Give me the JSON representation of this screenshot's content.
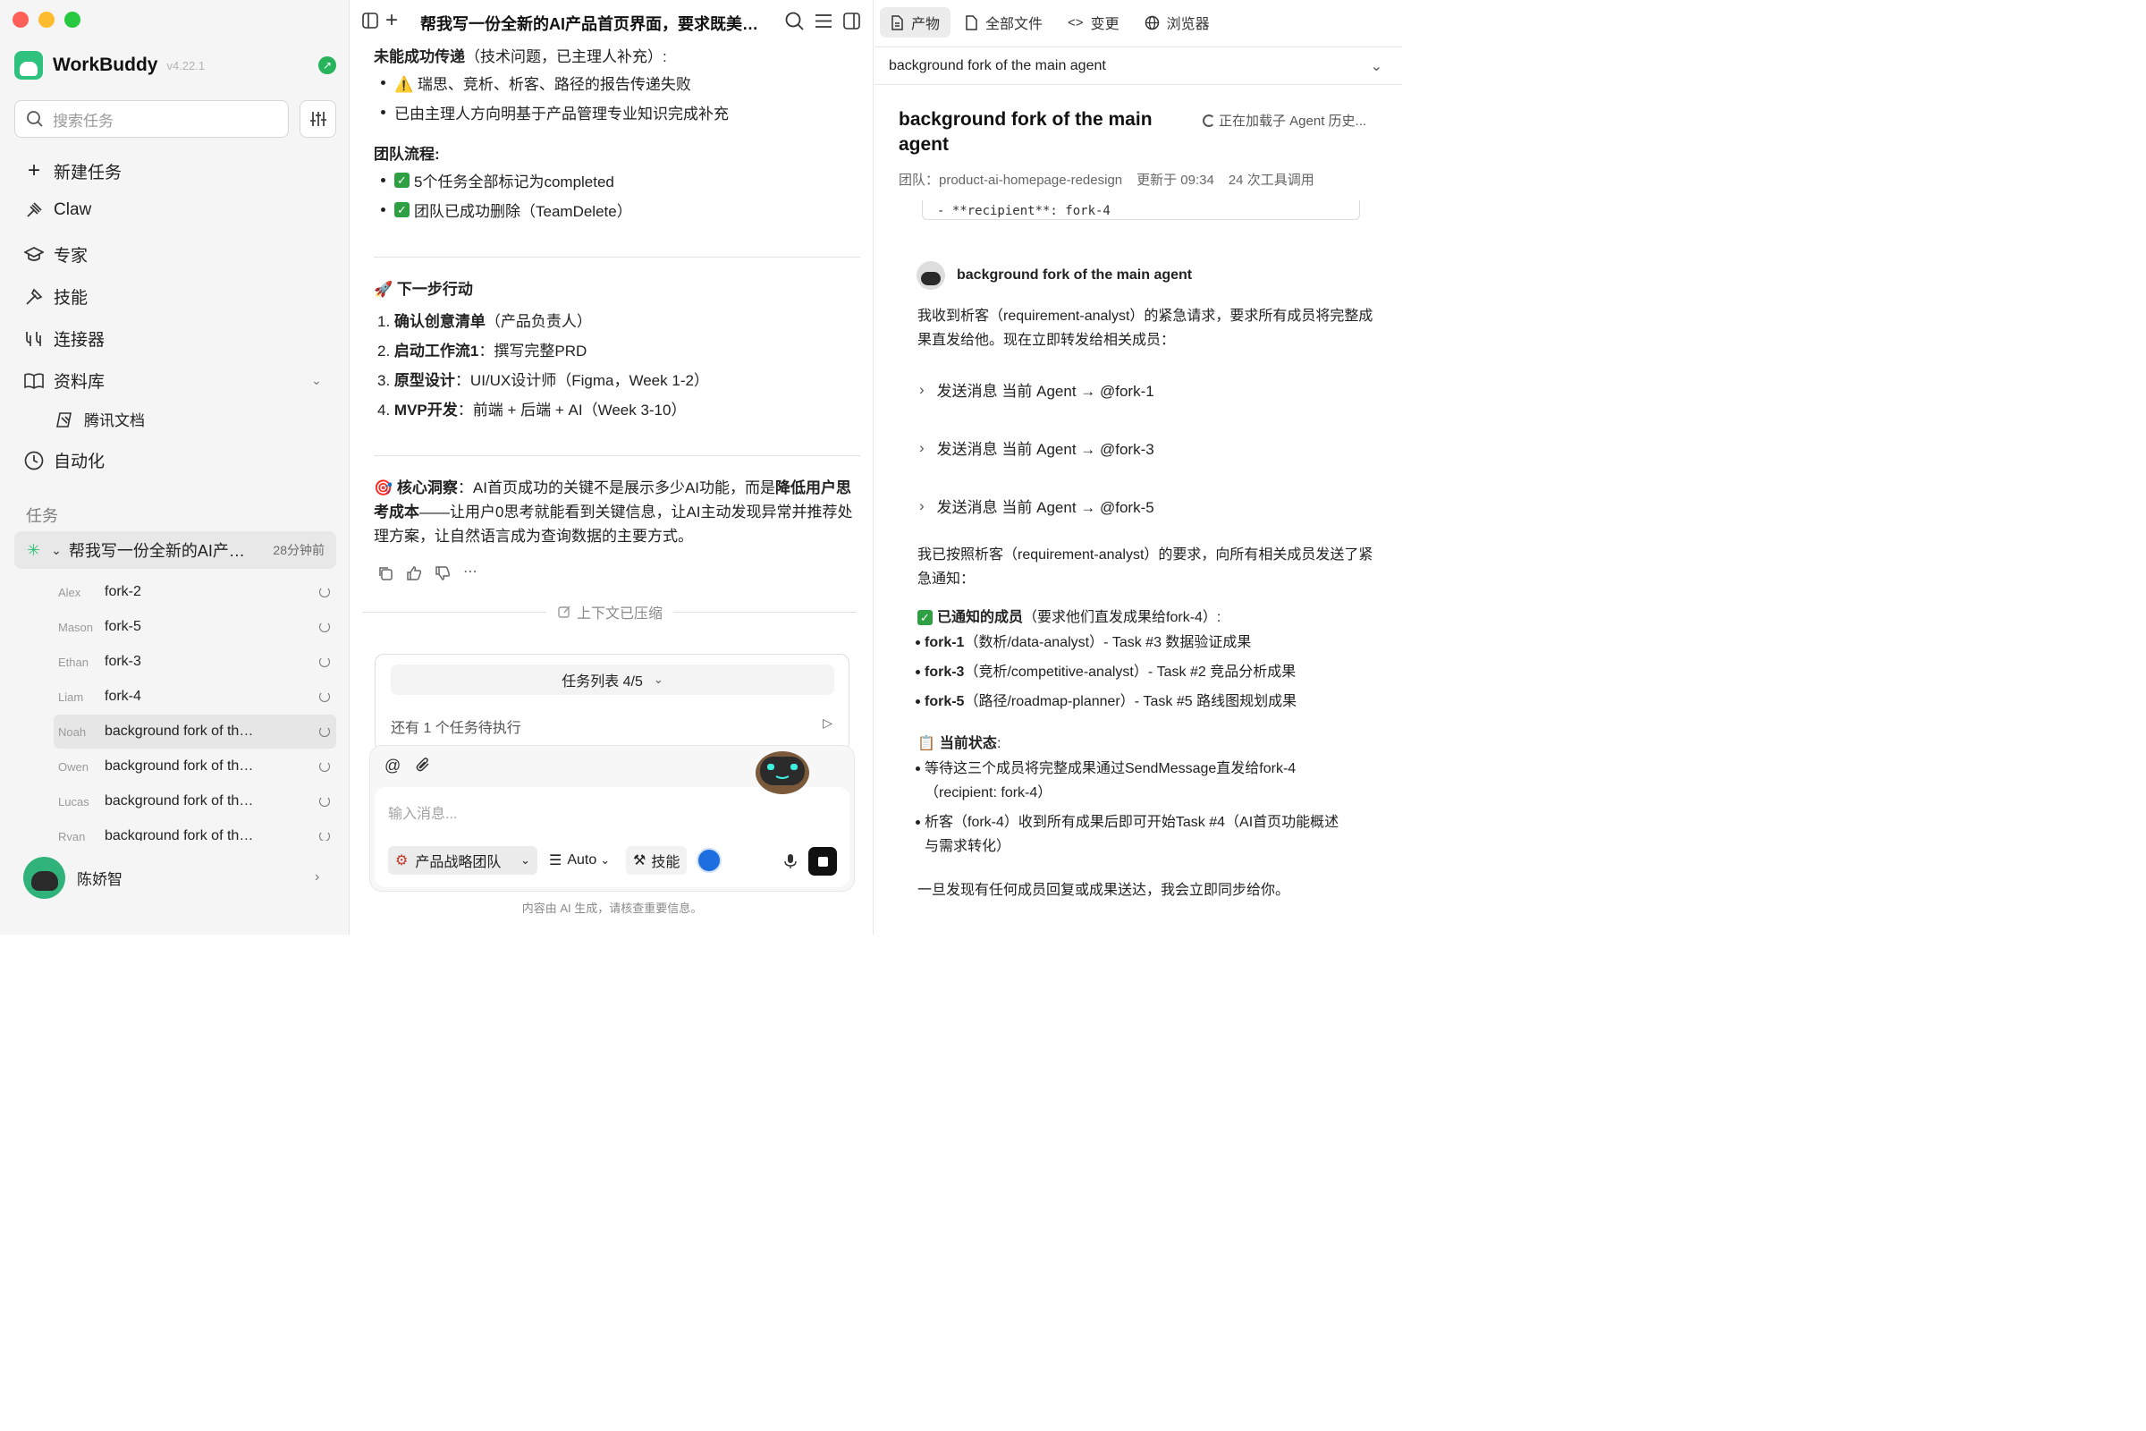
{
  "sidebar": {
    "brand": "WorkBuddy",
    "version": "v4.22.1",
    "search_placeholder": "搜索任务",
    "nav": [
      {
        "label": "新建任务",
        "icon": "plus-icon"
      },
      {
        "label": "Claw",
        "icon": "claw-icon"
      },
      {
        "label": "专家",
        "icon": "graduation-cap-icon"
      },
      {
        "label": "技能",
        "icon": "tools-icon"
      },
      {
        "label": "连接器",
        "icon": "connector-icon"
      },
      {
        "label": "资料库",
        "icon": "book-icon"
      },
      {
        "label": "腾讯文档",
        "icon": "doc-icon"
      },
      {
        "label": "自动化",
        "icon": "clock-icon"
      }
    ],
    "tasks_label": "任务",
    "current_task": {
      "title": "帮我写一份全新的AI产品首页界面，要求既美观又…",
      "time": "28分钟前"
    },
    "subtasks": [
      {
        "who": "Alex",
        "name": "fork-2"
      },
      {
        "who": "Mason",
        "name": "fork-5"
      },
      {
        "who": "Ethan",
        "name": "fork-3"
      },
      {
        "who": "Liam",
        "name": "fork-4"
      },
      {
        "who": "Noah",
        "name": "background fork of the main agent"
      },
      {
        "who": "Owen",
        "name": "background fork of the main agent"
      },
      {
        "who": "Lucas",
        "name": "background fork of the main agent"
      },
      {
        "who": "Ryan",
        "name": "background fork of the main agent"
      }
    ],
    "user_name": "陈娇智"
  },
  "middle": {
    "title": "帮我写一份全新的AI产品首页界面，要求既美观又实用",
    "failed_heading": "未能成功传递",
    "failed_note": "（技术问题，已主理人补充）:",
    "failed_items": [
      "⚠️ 瑞思、竞析、析客、路径的报告传递失败",
      "已由主理人方向明基于产品管理专业知识完成补充"
    ],
    "flow_heading": "团队流程:",
    "flow_items": [
      "5个任务全部标记为completed",
      "团队已成功删除（TeamDelete）"
    ],
    "next_heading": "🚀 下一步行动",
    "next_items": [
      {
        "n": "1.",
        "b": "确认创意清单",
        "r": "（产品负责人）"
      },
      {
        "n": "2.",
        "b": "启动工作流1",
        "r": "：撰写完整PRD"
      },
      {
        "n": "3.",
        "b": "原型设计",
        "r": "：UI/UX设计师（Figma，Week 1-2）"
      },
      {
        "n": "4.",
        "b": "MVP开发",
        "r": "：前端 + 后端 + AI（Week 3-10）"
      }
    ],
    "insight_label": "🎯 核心洞察",
    "insight_a": "：AI首页成功的关键不是展示多少AI功能，而是",
    "insight_b": "降低用户思考成本",
    "insight_c": "——让用户0思考就能看到关键信息，让AI主动发现异常并推荐处理方案，让自然语言成为查询数据的主要方式。",
    "compressed": "上下文已压缩",
    "tasklist_label": "任务列表 4/5",
    "pending": "还有 1 个任务待执行",
    "input_placeholder": "输入消息...",
    "team": "产品战略团队",
    "model": "Auto",
    "skills": "技能",
    "disclaimer": "内容由 AI 生成，请核查重要信息。"
  },
  "right": {
    "tabs": [
      "产物",
      "全部文件",
      "变更",
      "浏览器"
    ],
    "selector": "background fork of the main agent",
    "title": "background fork of the main agent",
    "loading": "正在加载子 Agent 历史...",
    "meta_team": "团队：product-ai-homepage-redesign",
    "meta_updated": "更新于 09:34",
    "meta_calls": "24 次工具调用",
    "code_line": "- **recipient**: fork-4",
    "agent_name": "background fork of the main agent",
    "p1": "我收到析客（requirement-analyst）的紧急请求，要求所有成员将完整成果直发给他。现在立即转发给相关成员：",
    "sends": [
      "发送消息 当前 Agent → @fork-1",
      "发送消息 当前 Agent → @fork-3",
      "发送消息 当前 Agent → @fork-5"
    ],
    "p2": "我已按照析客（requirement-analyst）的要求，向所有相关成员发送了紧急通知：",
    "notified_heading": "已通知的成员",
    "notified_note": "（要求他们直发成果给fork-4）:",
    "notified": [
      {
        "b": "fork-1",
        "r": "（数析/data-analyst）- Task #3 数据验证成果"
      },
      {
        "b": "fork-3",
        "r": "（竞析/competitive-analyst）- Task #2 竞品分析成果"
      },
      {
        "b": "fork-5",
        "r": "（路径/roadmap-planner）- Task #5 路线图规划成果"
      }
    ],
    "status_heading": "当前状态",
    "status_items": [
      "等待这三个成员将完整成果通过SendMessage直发给fork-4（recipient: fork-4）",
      "析客（fork-4）收到所有成果后即可开始Task #4（AI首页功能概述与需求转化）"
    ],
    "footer": "一旦发现有任何成员回复或成果送达，我会立即同步给你。"
  }
}
